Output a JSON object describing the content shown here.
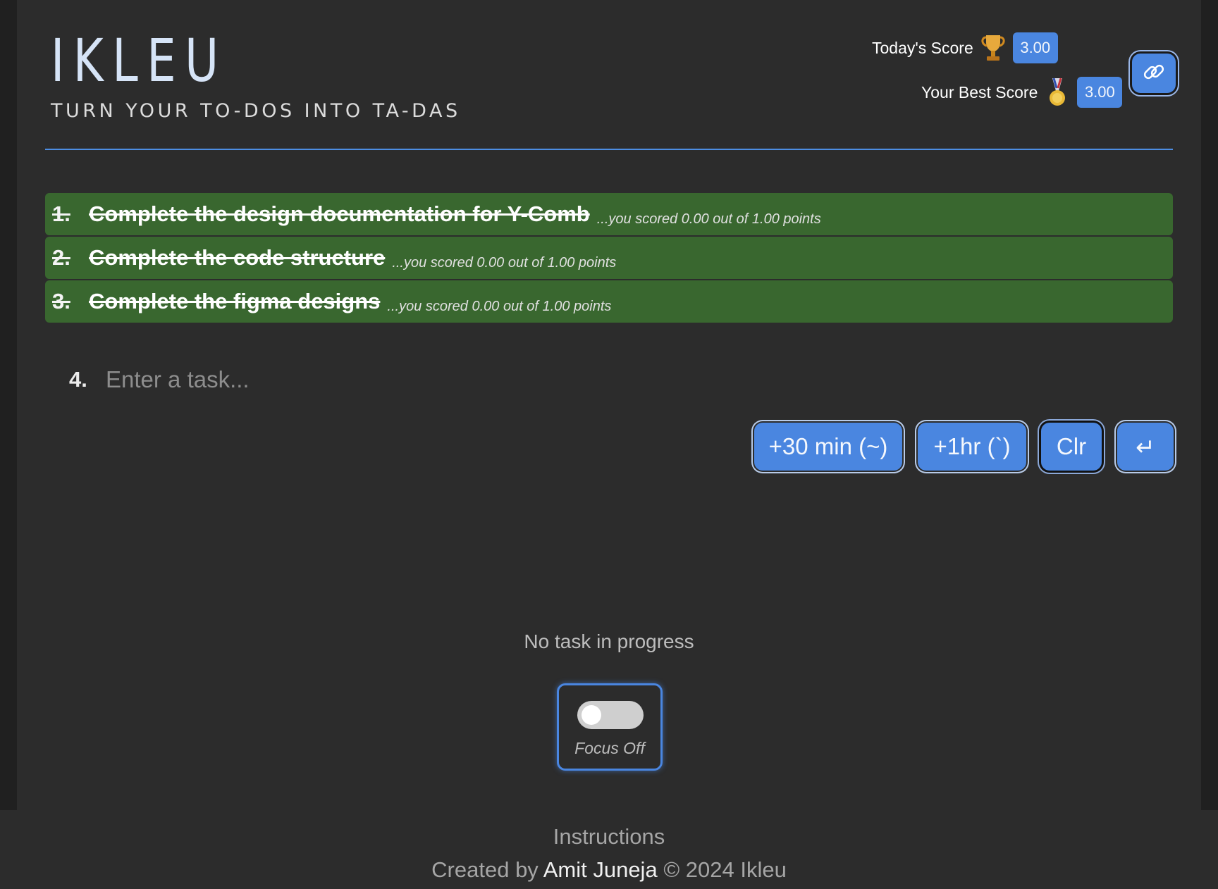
{
  "brand": {
    "logo": "IKLEU",
    "tagline": "TURN YOUR TO-DOS INTO TA-DAS"
  },
  "scores": {
    "today_label": "Today's Score",
    "today_value": "3.00",
    "best_label": "Your Best Score",
    "best_value": "3.00"
  },
  "tasks": [
    {
      "num": "1.",
      "title": "Complete the design documentation for Y-Comb",
      "note": "...you scored 0.00 out of 1.00 points"
    },
    {
      "num": "2.",
      "title": "Complete the code structure",
      "note": "...you scored 0.00 out of 1.00 points"
    },
    {
      "num": "3.",
      "title": "Complete the figma designs",
      "note": "...you scored 0.00 out of 1.00 points"
    }
  ],
  "new_task": {
    "num": "4.",
    "placeholder": "Enter a task..."
  },
  "buttons": {
    "add30": "+30 min (~)",
    "add1hr": "+1hr (`)",
    "clear": "Clr",
    "enter": "↵"
  },
  "status": "No task in progress",
  "focus": {
    "label": "Focus Off",
    "enabled": false
  },
  "footer": {
    "instructions": "Instructions",
    "created_prefix": "Created by",
    "author": "Amit Juneja",
    "copyright": "© 2024 Ikleu"
  },
  "colors": {
    "accent": "#4a86e0",
    "task_done_bg": "#39672f",
    "background": "#2c2c2c"
  },
  "icons": {
    "today": "trophy-icon",
    "best": "medal-icon",
    "share": "link-icon",
    "enter": "enter-icon"
  }
}
